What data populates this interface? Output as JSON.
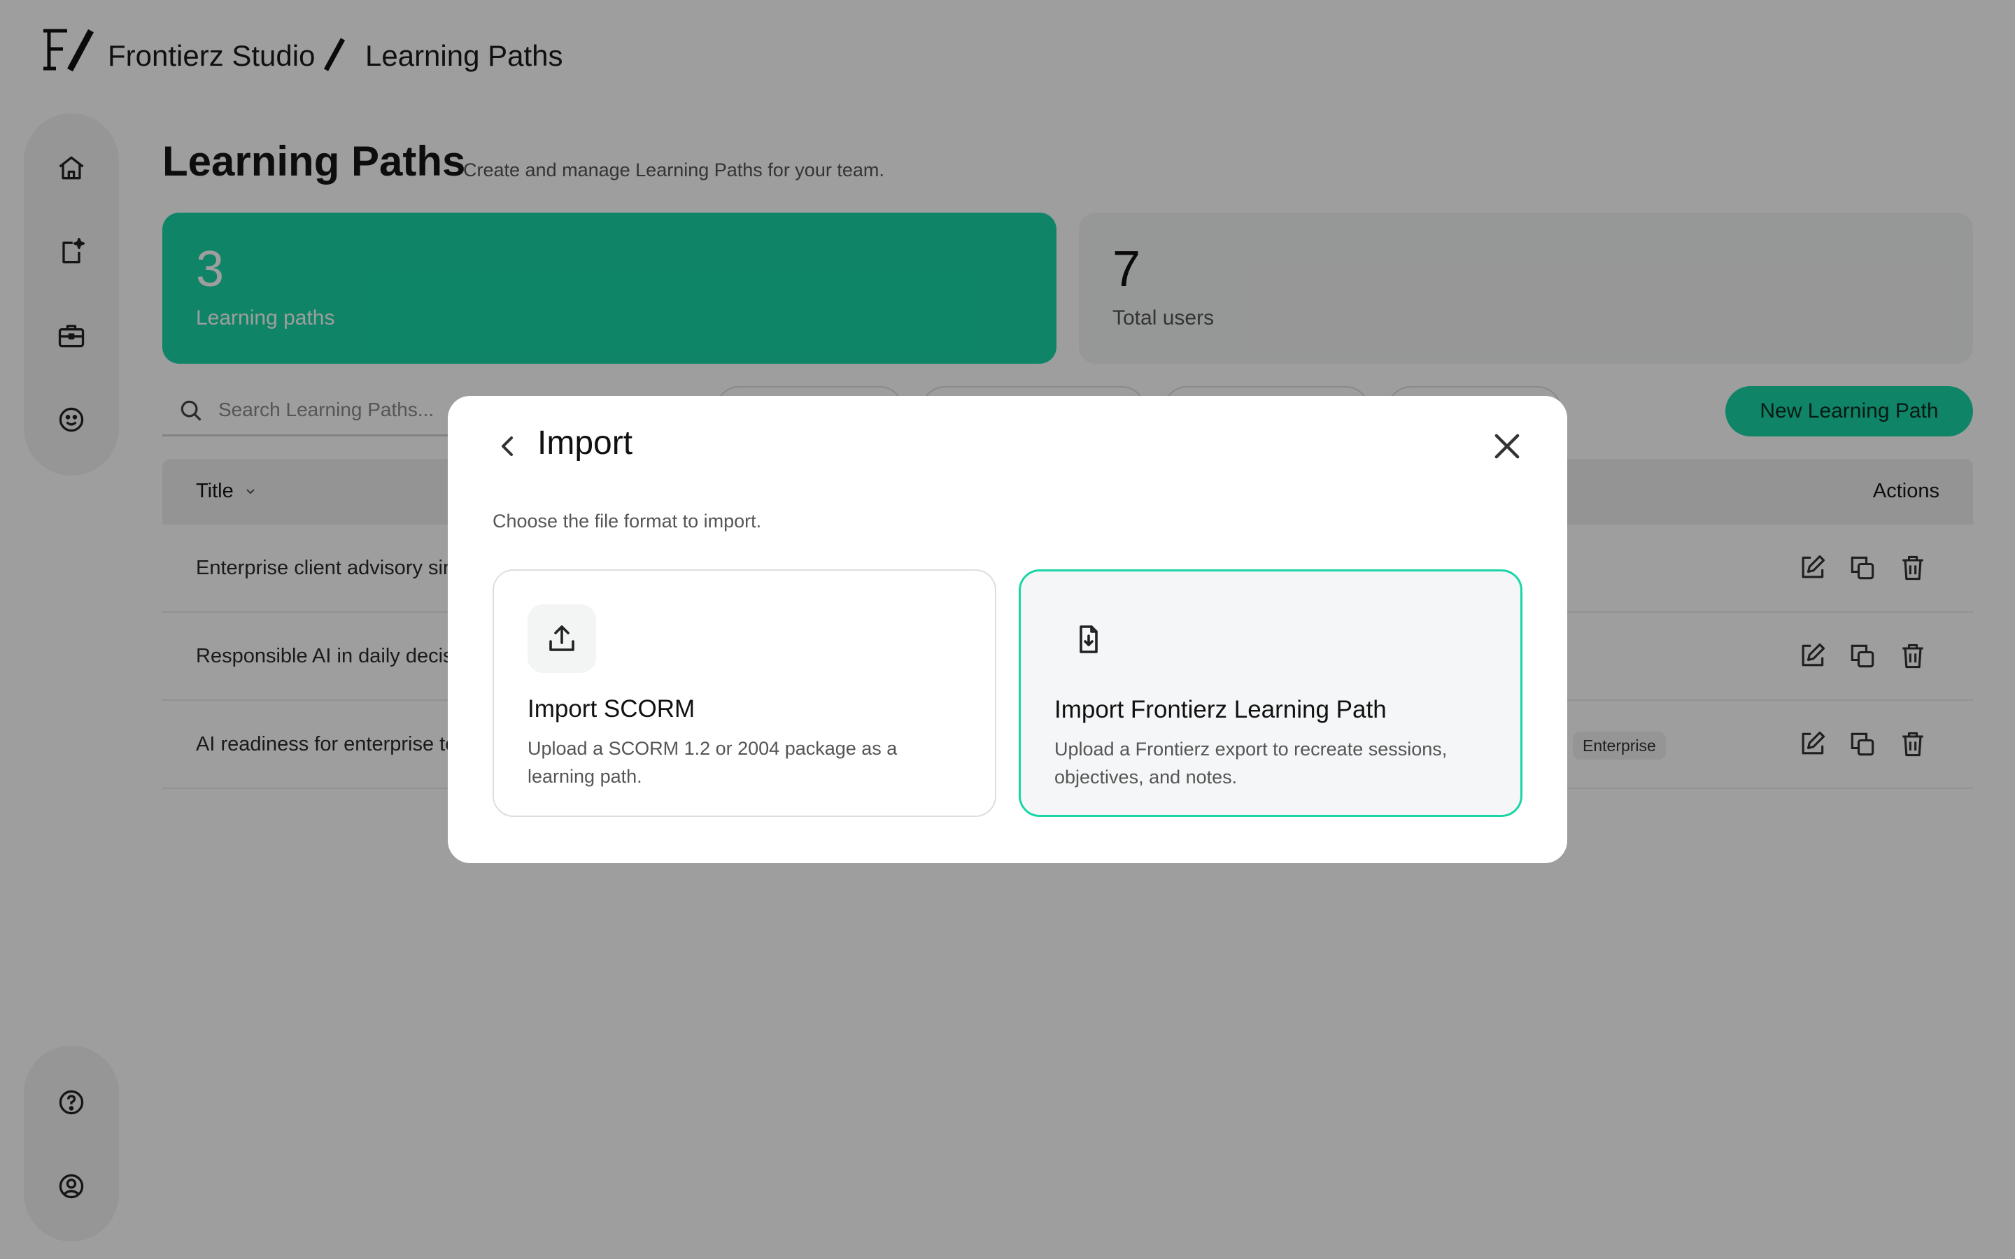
{
  "app": {
    "brand": "Frontierz Studio",
    "breadcrumb_page": "Learning Paths"
  },
  "sidebar": {
    "top_icons": [
      "home-icon",
      "new-document-sparkle-icon",
      "briefcase-icon",
      "smiley-icon"
    ],
    "bottom_icons": [
      "help-icon",
      "profile-icon"
    ]
  },
  "page": {
    "title": "Learning Paths",
    "subtitle": "Create and manage Learning Paths for your team."
  },
  "stats": [
    {
      "value": "3",
      "label": "Learning paths"
    },
    {
      "value": "7",
      "label": "Total users"
    }
  ],
  "search": {
    "placeholder": "Search Learning Paths..."
  },
  "toolbar": {
    "new_label": "New Learning Path"
  },
  "table": {
    "headers": {
      "title": "Title",
      "actions": "Actions"
    },
    "rows": [
      {
        "title": "Enterprise client advisory sin",
        "tag": ""
      },
      {
        "title": "Responsible AI in daily decisi",
        "tag": ""
      },
      {
        "title": "AI readiness for enterprise te",
        "tag": "Enterprise"
      }
    ]
  },
  "modal": {
    "title": "Import",
    "description": "Choose the file format to import.",
    "options": [
      {
        "title": "Import SCORM",
        "text": "Upload a SCORM 1.2 or 2004 package as a learning path.",
        "icon": "upload-icon"
      },
      {
        "title": "Import Frontierz Learning Path",
        "text": "Upload a Frontierz export to recreate sessions, objectives, and notes.",
        "icon": "file-download-icon",
        "selected": true
      }
    ]
  },
  "colors": {
    "accent": "#19d6a7",
    "selected_card_bg": "#f5f6f7",
    "sidebar_bg": "#f2f3f3"
  }
}
